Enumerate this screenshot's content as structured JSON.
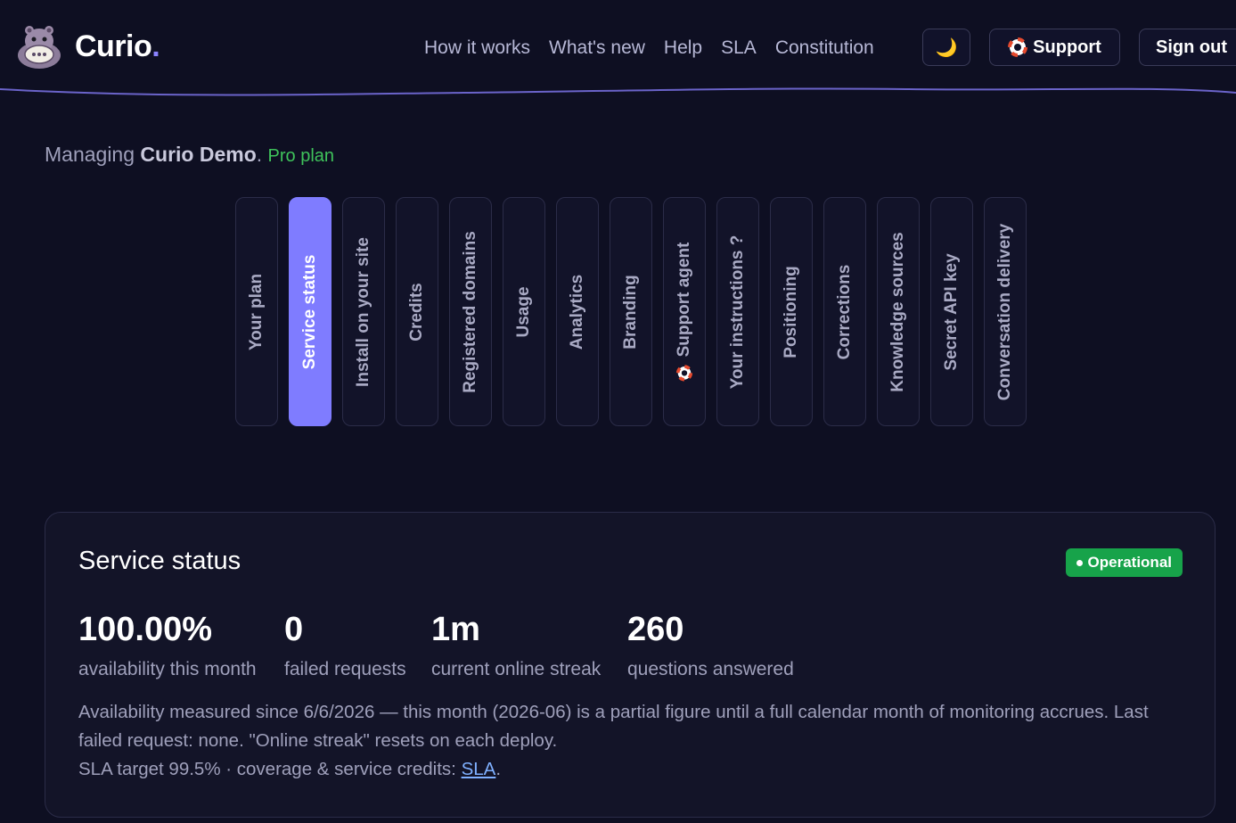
{
  "brand": {
    "name": "Curio",
    "dot": "."
  },
  "nav": {
    "items": [
      "How it works",
      "What's new",
      "Help",
      "SLA",
      "Constitution"
    ]
  },
  "header": {
    "theme_icon": "moon-icon",
    "support_label": "Support",
    "signout_label": "Sign out"
  },
  "managing": {
    "prefix": "Managing ",
    "org": "Curio Demo",
    "separator": ".",
    "plan": "Pro plan"
  },
  "tabs": [
    {
      "label": "Your plan",
      "active": false
    },
    {
      "label": "Service status",
      "active": true
    },
    {
      "label": "Install on your site",
      "active": false
    },
    {
      "label": "Credits",
      "active": false
    },
    {
      "label": "Registered domains",
      "active": false
    },
    {
      "label": "Usage",
      "active": false
    },
    {
      "label": "Analytics",
      "active": false
    },
    {
      "label": "Branding",
      "active": false
    },
    {
      "label": "Support agent",
      "active": false,
      "icon": "lifebuoy-icon"
    },
    {
      "label": "Your instructions ?",
      "active": false
    },
    {
      "label": "Positioning",
      "active": false
    },
    {
      "label": "Corrections",
      "active": false
    },
    {
      "label": "Knowledge sources",
      "active": false
    },
    {
      "label": "Secret API key",
      "active": false
    },
    {
      "label": "Conversation delivery",
      "active": false
    }
  ],
  "card": {
    "title": "Service status",
    "badge": "Operational",
    "stats": [
      {
        "value": "100.00%",
        "label": "availability this month"
      },
      {
        "value": "0",
        "label": "failed requests"
      },
      {
        "value": "1m",
        "label": "current online streak"
      },
      {
        "value": "260",
        "label": "questions answered"
      }
    ],
    "note": "Availability measured since 6/6/2026 — this month (2026-06) is a partial figure until a full calendar month of monitoring accrues. Last failed request: none. \"Online streak\" resets on each deploy.",
    "sla_prefix": "SLA target 99.5% · coverage & service credits: ",
    "sla_link": "SLA",
    "sla_suffix": "."
  },
  "colors": {
    "background": "#0e0f22",
    "accent": "#7f7cff",
    "plan_green": "#3fc35b",
    "operational_green": "#17a34a",
    "link": "#7fb0ff"
  }
}
